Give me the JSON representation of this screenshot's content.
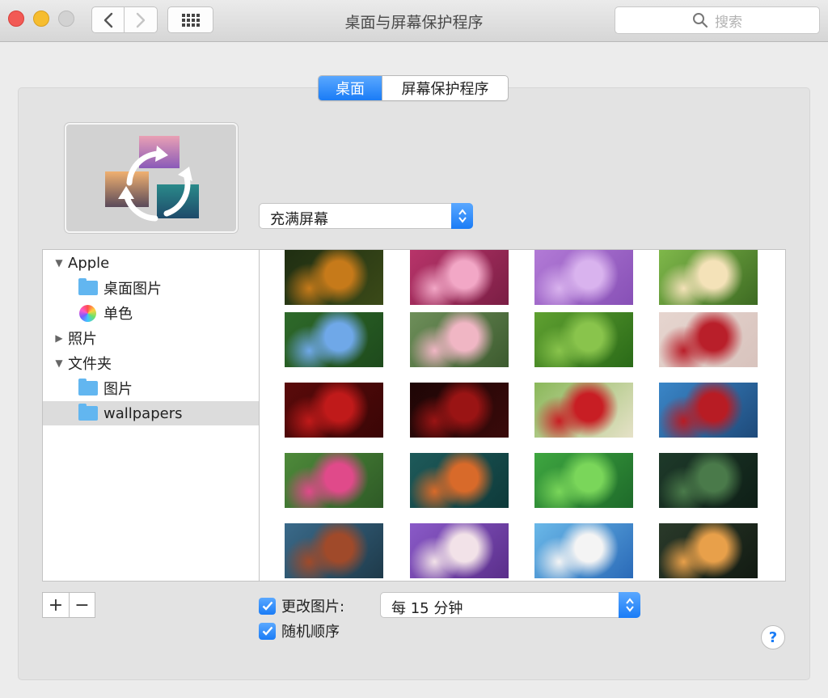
{
  "window": {
    "title": "桌面与屏幕保护程序",
    "search_placeholder": "搜索"
  },
  "tabs": [
    {
      "label": "桌面",
      "active": true
    },
    {
      "label": "屏幕保护程序",
      "active": false
    }
  ],
  "fill_mode": {
    "selected": "充满屏幕"
  },
  "sidebar": {
    "items": [
      {
        "label": "Apple",
        "disclosure": "expanded",
        "icon": "none",
        "level": 0,
        "selected": false
      },
      {
        "label": "桌面图片",
        "disclosure": "none",
        "icon": "folder-icon",
        "level": 1,
        "selected": false
      },
      {
        "label": "单色",
        "disclosure": "none",
        "icon": "color-wheel-icon",
        "level": 1,
        "selected": false
      },
      {
        "label": "照片",
        "disclosure": "collapsed",
        "icon": "none",
        "level": 0,
        "selected": false
      },
      {
        "label": "文件夹",
        "disclosure": "expanded",
        "icon": "none",
        "level": 0,
        "selected": false
      },
      {
        "label": "图片",
        "disclosure": "none",
        "icon": "pictures-folder-icon",
        "level": 1,
        "selected": false
      },
      {
        "label": "wallpapers",
        "disclosure": "none",
        "icon": "folder-icon",
        "level": 1,
        "selected": true
      }
    ]
  },
  "wallpapers": {
    "thumbnails": [
      {
        "name": "orange-flower-thumb",
        "colors": [
          "#1f2e12",
          "#c67a1a",
          "#3b4a18"
        ]
      },
      {
        "name": "pink-flower-thumb",
        "colors": [
          "#b8346a",
          "#f2a7c6",
          "#7a1e44"
        ]
      },
      {
        "name": "lilac-hydrangea-thumb",
        "colors": [
          "#b27ad6",
          "#d9b3ee",
          "#8750b6"
        ]
      },
      {
        "name": "plumeria-thumb",
        "colors": [
          "#7fb84a",
          "#f4e2b8",
          "#3d6a22"
        ]
      },
      {
        "name": "blue-hydrangea-thumb",
        "colors": [
          "#2e6a2a",
          "#6fa8e8",
          "#1e4a1c"
        ]
      },
      {
        "name": "pink-blossom-thumb",
        "colors": [
          "#6e8f5a",
          "#f0b6c4",
          "#3c5a2e"
        ]
      },
      {
        "name": "forget-me-not-thumb",
        "colors": [
          "#5fa030",
          "#89c44c",
          "#2a6a18"
        ]
      },
      {
        "name": "rose-on-table-thumb",
        "colors": [
          "#e6d5cf",
          "#b91f2a",
          "#d8c3bd"
        ]
      },
      {
        "name": "red-roses-thumb",
        "colors": [
          "#5a0a0a",
          "#c01a1a",
          "#3a0606"
        ]
      },
      {
        "name": "rose-petals-dark-thumb",
        "colors": [
          "#1e0606",
          "#9a1414",
          "#3a0a0a"
        ]
      },
      {
        "name": "roses-on-grass-thumb",
        "colors": [
          "#8ab85a",
          "#c81e24",
          "#e6e2c8"
        ]
      },
      {
        "name": "red-rose-blue-thumb",
        "colors": [
          "#3a86c8",
          "#b81c24",
          "#1e4a7a"
        ]
      },
      {
        "name": "pink-rose-bouquet-thumb",
        "colors": [
          "#4e8a3a",
          "#e04a8a",
          "#2e5a26"
        ]
      },
      {
        "name": "autumn-leaves-thumb",
        "colors": [
          "#1e5a5a",
          "#d86a2a",
          "#0e3a3a"
        ]
      },
      {
        "name": "green-leaves-thumb",
        "colors": [
          "#3ea640",
          "#7ad65a",
          "#1e6a2a"
        ]
      },
      {
        "name": "forest-branch-thumb",
        "colors": [
          "#1e3a2a",
          "#4a7a4a",
          "#0e1e16"
        ]
      },
      {
        "name": "branch-bokeh-thumb",
        "colors": [
          "#3a6a8a",
          "#a04a2a",
          "#1e3a4a"
        ]
      },
      {
        "name": "tulip-bouquet-thumb",
        "colors": [
          "#8a5ac8",
          "#f2e2e8",
          "#5a2e8a"
        ]
      },
      {
        "name": "snow-coast-thumb",
        "colors": [
          "#6ab8e8",
          "#f4f4f4",
          "#2a6ab8"
        ]
      },
      {
        "name": "forest-sunlight-thumb",
        "colors": [
          "#2a3a2a",
          "#e8a04a",
          "#121a12"
        ]
      }
    ]
  },
  "footer": {
    "add_label": "+",
    "remove_label": "−",
    "change_picture": {
      "label": "更改图片:",
      "checked": true
    },
    "interval": {
      "selected": "每 15 分钟"
    },
    "random_order": {
      "label": "随机顺序",
      "checked": true
    },
    "help_label": "?"
  }
}
